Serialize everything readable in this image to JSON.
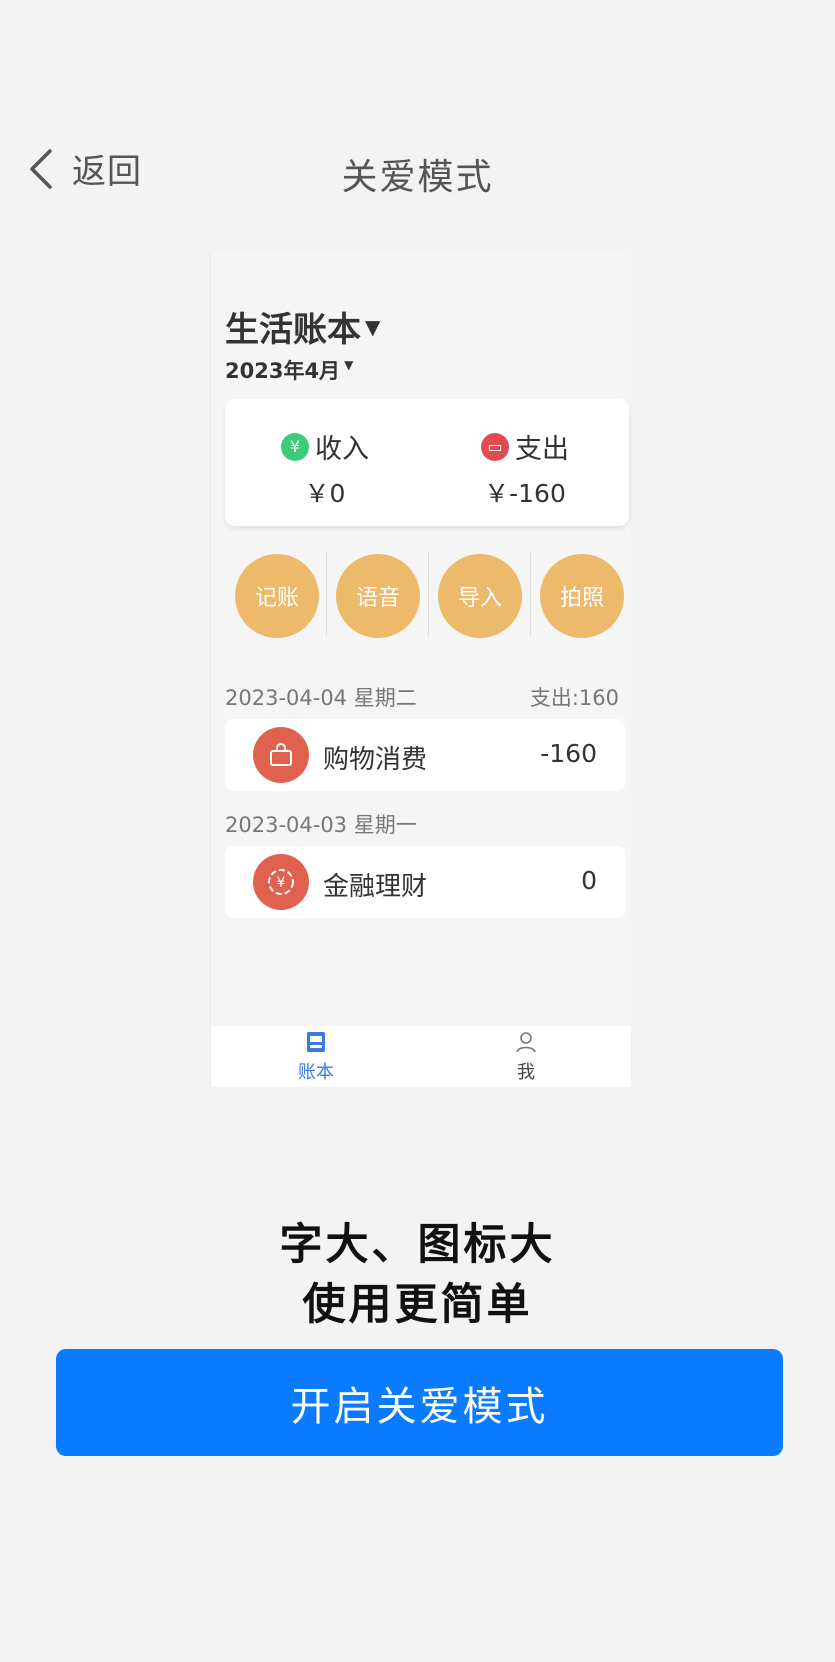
{
  "header": {
    "back_label": "返回",
    "title": "关爱模式"
  },
  "preview": {
    "book_title": "生活账本",
    "month": "2023年4月",
    "summary": {
      "income_label": "收入",
      "income_value": "￥0",
      "expense_label": "支出",
      "expense_value": "￥-160"
    },
    "actions": [
      "记账",
      "语音",
      "导入",
      "拍照"
    ],
    "days": [
      {
        "date": "2023-04-04 星期二",
        "total": "支出:160",
        "record": {
          "name": "购物消费",
          "amount": "-160"
        }
      },
      {
        "date": "2023-04-03 星期一",
        "total": "",
        "record": {
          "name": "金融理财",
          "amount": "0"
        }
      }
    ],
    "tabs": [
      {
        "label": "账本"
      },
      {
        "label": "我"
      }
    ],
    "colors": {
      "accent": "#3a7be0",
      "action": "#edb96a",
      "record_icon": "#e0624e"
    }
  },
  "promo": {
    "line1": "字大、图标大",
    "line2": "使用更简单"
  },
  "cta": {
    "label": "开启关爱模式",
    "color": "#0a7aff"
  }
}
